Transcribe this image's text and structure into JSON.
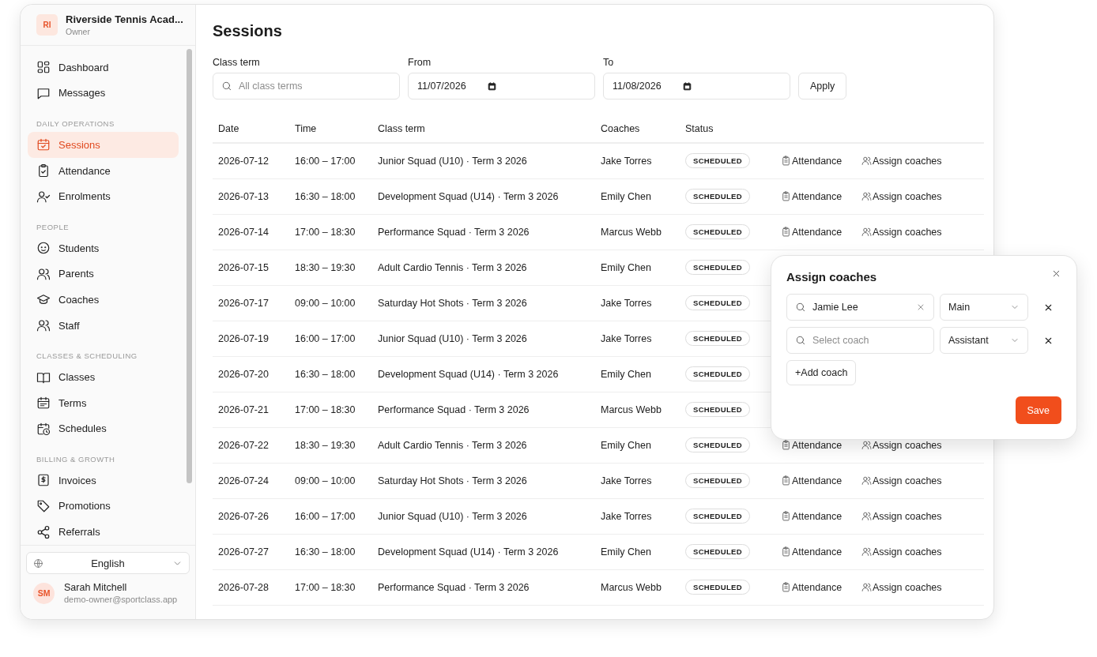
{
  "sidebar": {
    "org": {
      "initials": "RI",
      "name": "Riverside Tennis Acad...",
      "role": "Owner"
    },
    "groups": [
      {
        "items": [
          {
            "label": "Dashboard",
            "selected": false
          },
          {
            "label": "Messages",
            "selected": false
          }
        ]
      },
      {
        "title": "DAILY OPERATIONS",
        "items": [
          {
            "label": "Sessions",
            "selected": true
          },
          {
            "label": "Attendance",
            "selected": false
          },
          {
            "label": "Enrolments",
            "selected": false
          }
        ]
      },
      {
        "title": "PEOPLE",
        "items": [
          {
            "label": "Students",
            "selected": false
          },
          {
            "label": "Parents",
            "selected": false
          },
          {
            "label": "Coaches",
            "selected": false
          },
          {
            "label": "Staff",
            "selected": false
          }
        ]
      },
      {
        "title": "CLASSES & SCHEDULING",
        "items": [
          {
            "label": "Classes",
            "selected": false
          },
          {
            "label": "Terms",
            "selected": false
          },
          {
            "label": "Schedules",
            "selected": false
          }
        ]
      },
      {
        "title": "BILLING & GROWTH",
        "items": [
          {
            "label": "Invoices",
            "selected": false
          },
          {
            "label": "Promotions",
            "selected": false
          },
          {
            "label": "Referrals",
            "selected": false
          }
        ]
      }
    ],
    "language": "English",
    "user": {
      "initials": "SM",
      "name": "Sarah Mitchell",
      "email": "demo-owner@sportclass.app"
    }
  },
  "page": {
    "title": "Sessions"
  },
  "filters": {
    "class_term": {
      "label": "Class term",
      "placeholder": "All class terms"
    },
    "from": {
      "label": "From",
      "value": "11/07/2026"
    },
    "to": {
      "label": "To",
      "value": "11/08/2026"
    },
    "apply": "Apply"
  },
  "table": {
    "columns": [
      "Date",
      "Time",
      "Class term",
      "Coaches",
      "Status"
    ],
    "rows": [
      {
        "date": "2026-07-12",
        "time": "16:00 – 17:00",
        "class_term": "Junior Squad (U10) · Term 3 2026",
        "coaches": "Jake Torres",
        "status": "SCHEDULED",
        "actions": [
          "Attendance",
          "Assign coaches"
        ]
      },
      {
        "date": "2026-07-13",
        "time": "16:30 – 18:00",
        "class_term": "Development Squad (U14) · Term 3 2026",
        "coaches": "Emily Chen",
        "status": "SCHEDULED",
        "actions": [
          "Attendance",
          "Assign coaches"
        ]
      },
      {
        "date": "2026-07-14",
        "time": "17:00 – 18:30",
        "class_term": "Performance Squad · Term 3 2026",
        "coaches": "Marcus Webb",
        "status": "SCHEDULED",
        "actions": [
          "Attendance",
          "Assign coaches"
        ]
      },
      {
        "date": "2026-07-15",
        "time": "18:30 – 19:30",
        "class_term": "Adult Cardio Tennis · Term 3 2026",
        "coaches": "Emily Chen",
        "status": "SCHEDULED"
      },
      {
        "date": "2026-07-17",
        "time": "09:00 – 10:00",
        "class_term": "Saturday Hot Shots · Term 3 2026",
        "coaches": "Jake Torres",
        "status": "SCHEDULED"
      },
      {
        "date": "2026-07-19",
        "time": "16:00 – 17:00",
        "class_term": "Junior Squad (U10) · Term 3 2026",
        "coaches": "Jake Torres",
        "status": "SCHEDULED"
      },
      {
        "date": "2026-07-20",
        "time": "16:30 – 18:00",
        "class_term": "Development Squad (U14) · Term 3 2026",
        "coaches": "Emily Chen",
        "status": "SCHEDULED"
      },
      {
        "date": "2026-07-21",
        "time": "17:00 – 18:30",
        "class_term": "Performance Squad · Term 3 2026",
        "coaches": "Marcus Webb",
        "status": "SCHEDULED"
      },
      {
        "date": "2026-07-22",
        "time": "18:30 – 19:30",
        "class_term": "Adult Cardio Tennis · Term 3 2026",
        "coaches": "Emily Chen",
        "status": "SCHEDULED",
        "actions": [
          "Attendance",
          "Assign coaches"
        ]
      },
      {
        "date": "2026-07-24",
        "time": "09:00 – 10:00",
        "class_term": "Saturday Hot Shots · Term 3 2026",
        "coaches": "Jake Torres",
        "status": "SCHEDULED",
        "actions": [
          "Attendance",
          "Assign coaches"
        ]
      },
      {
        "date": "2026-07-26",
        "time": "16:00 – 17:00",
        "class_term": "Junior Squad (U10) · Term 3 2026",
        "coaches": "Jake Torres",
        "status": "SCHEDULED",
        "actions": [
          "Attendance",
          "Assign coaches"
        ]
      },
      {
        "date": "2026-07-27",
        "time": "16:30 – 18:00",
        "class_term": "Development Squad (U14) · Term 3 2026",
        "coaches": "Emily Chen",
        "status": "SCHEDULED",
        "actions": [
          "Attendance",
          "Assign coaches"
        ]
      },
      {
        "date": "2026-07-28",
        "time": "17:00 – 18:30",
        "class_term": "Performance Squad · Term 3 2026",
        "coaches": "Marcus Webb",
        "status": "SCHEDULED",
        "actions": [
          "Attendance",
          "Assign coaches"
        ]
      }
    ]
  },
  "popover": {
    "title": "Assign coaches",
    "rows": [
      {
        "value": "Jamie Lee",
        "role": "Main"
      },
      {
        "placeholder": "Select coach",
        "role": "Assistant"
      }
    ],
    "add": "+Add coach",
    "save": "Save"
  }
}
